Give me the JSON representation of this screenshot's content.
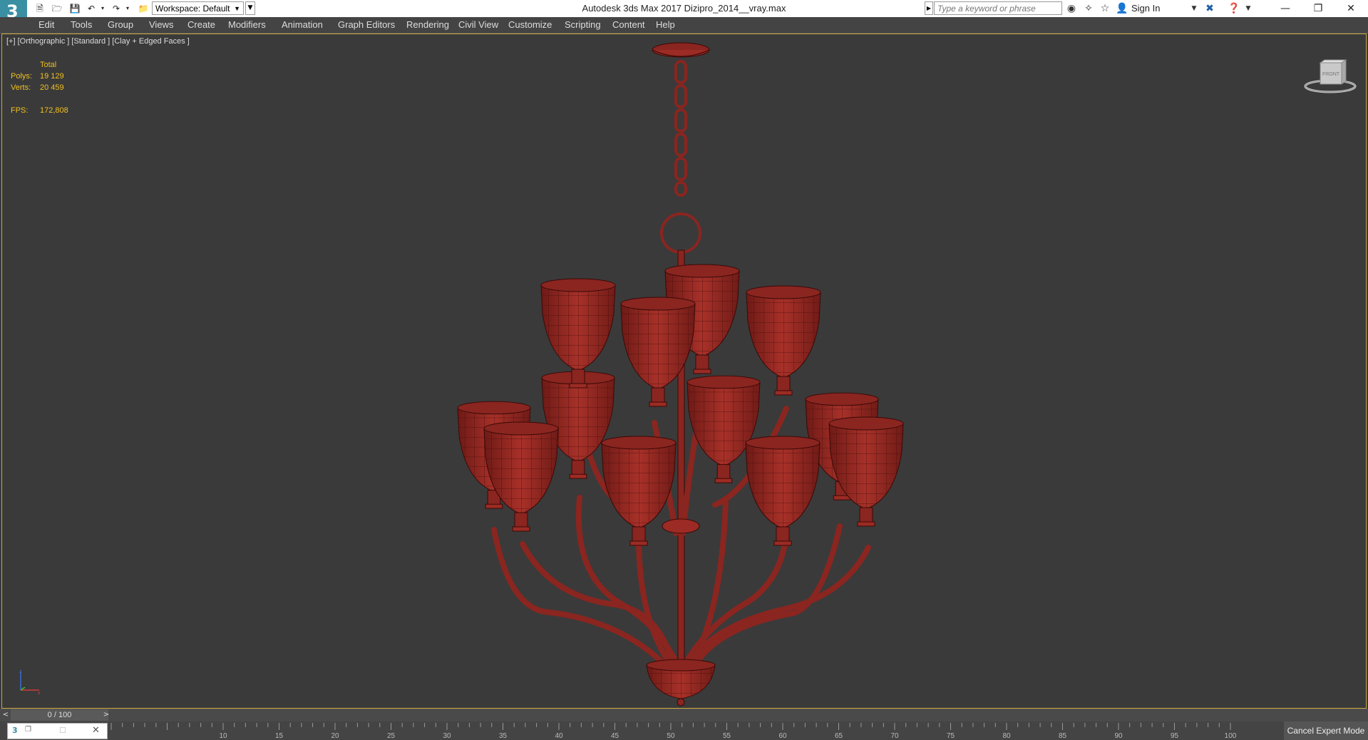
{
  "app": {
    "window_title": "Autodesk 3ds Max 2017     Dizipro_2014__vray.max",
    "logo_text": "3"
  },
  "toolbar": {
    "workspace_label": "Workspace: Default",
    "search_placeholder": "Type a keyword or phrase",
    "sign_in_label": "Sign In"
  },
  "menu": [
    "Edit",
    "Tools",
    "Group",
    "Views",
    "Create",
    "Modifiers",
    "Animation",
    "Graph Editors",
    "Rendering",
    "Civil View",
    "Customize",
    "Scripting",
    "Content",
    "Help"
  ],
  "viewport": {
    "label": "[+] [Orthographic ] [Standard ] [Clay + Edged Faces ]",
    "stats": {
      "total_label": "Total",
      "polys_label": "Polys:",
      "polys_value": "19 129",
      "verts_label": "Verts:",
      "verts_value": "20 459",
      "fps_label": "FPS:",
      "fps_value": "172,808"
    },
    "viewcube_label": "FRONT",
    "model_color": "#9e2a24"
  },
  "timeline": {
    "frame_readout": "0 / 100",
    "ticks": [
      "10",
      "15",
      "20",
      "25",
      "30",
      "35",
      "40",
      "45",
      "50",
      "55",
      "60",
      "65",
      "70",
      "75",
      "80",
      "85",
      "90",
      "95",
      "100"
    ]
  },
  "statusbar": {
    "cancel_label": "Cancel Expert Mode"
  },
  "icons": {
    "new": "new-file-icon",
    "open": "open-folder-icon",
    "save": "save-icon",
    "undo": "undo-icon",
    "redo": "redo-icon",
    "project": "project-folder-icon",
    "binoculars": "binoculars-icon",
    "star": "star-icon",
    "help": "help-icon",
    "exchange": "exchange-icon"
  }
}
